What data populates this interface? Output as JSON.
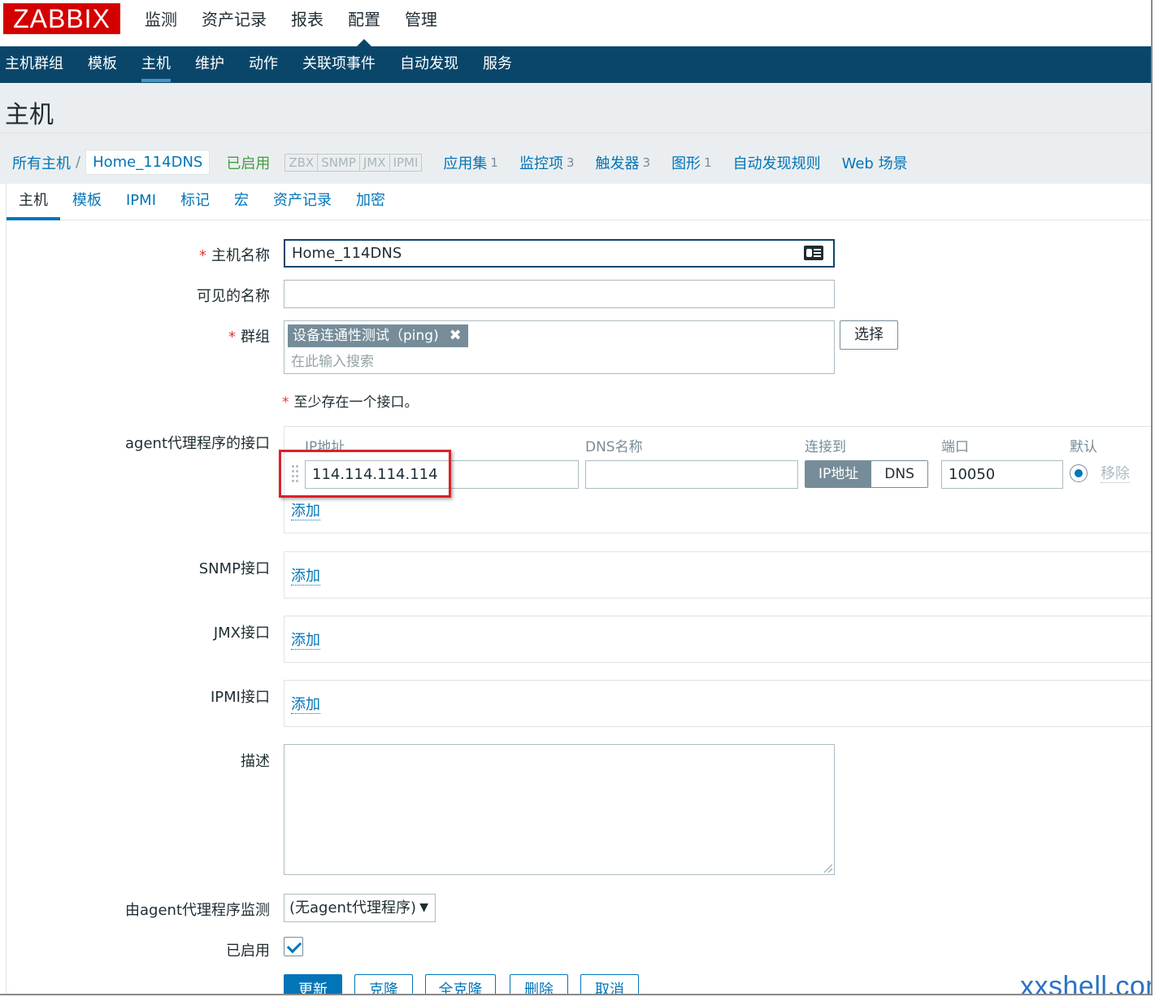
{
  "brand": {
    "logo": "ZABBIX"
  },
  "main_menu": [
    {
      "label": "监测"
    },
    {
      "label": "资产记录"
    },
    {
      "label": "报表"
    },
    {
      "label": "配置",
      "active": true
    },
    {
      "label": "管理"
    }
  ],
  "sub_menu": [
    {
      "label": "主机群组"
    },
    {
      "label": "模板"
    },
    {
      "label": "主机",
      "active": true
    },
    {
      "label": "维护"
    },
    {
      "label": "动作"
    },
    {
      "label": "关联项事件"
    },
    {
      "label": "自动发现"
    },
    {
      "label": "服务"
    }
  ],
  "page": {
    "title": "主机"
  },
  "breadcrumb": {
    "all_hosts": "所有主机",
    "separator": "/",
    "current_host": "Home_114DNS",
    "status": "已启用",
    "availability": [
      "ZBX",
      "SNMP",
      "JMX",
      "IPMI"
    ],
    "links": [
      {
        "label": "应用集",
        "count": "1"
      },
      {
        "label": "监控项",
        "count": "3"
      },
      {
        "label": "触发器",
        "count": "3"
      },
      {
        "label": "图形",
        "count": "1"
      },
      {
        "label": "自动发现规则",
        "count": ""
      },
      {
        "label": "Web 场景",
        "count": ""
      }
    ]
  },
  "tabs": [
    {
      "label": "主机",
      "active": true
    },
    {
      "label": "模板"
    },
    {
      "label": "IPMI"
    },
    {
      "label": "标记"
    },
    {
      "label": "宏"
    },
    {
      "label": "资产记录"
    },
    {
      "label": "加密"
    }
  ],
  "form": {
    "required_mark": "*",
    "host_name_label": "主机名称",
    "host_name_value": "Home_114DNS",
    "visible_name_label": "可见的名称",
    "visible_name_value": "",
    "groups_label": "群组",
    "group_tag": "设备连通性测试（ping)",
    "group_tag_remove": "✖",
    "groups_placeholder": "在此输入搜索",
    "select_button": "选择",
    "interface_note": "至少存在一个接口。",
    "agent_interfaces_label": "agent代理程序的接口",
    "iface_columns": {
      "ip": "IP地址",
      "dns": "DNS名称",
      "connect": "连接到",
      "port": "端口",
      "default": "默认"
    },
    "agent_interface": {
      "ip": "114.114.114.114",
      "dns": "",
      "connect_ip": "IP地址",
      "connect_dns": "DNS",
      "connect_selected": "IP地址",
      "port": "10050",
      "remove": "移除"
    },
    "add_link": "添加",
    "snmp_label": "SNMP接口",
    "jmx_label": "JMX接口",
    "ipmi_label": "IPMI接口",
    "description_label": "描述",
    "description_value": "",
    "proxy_label": "由agent代理程序监测",
    "proxy_value": "(无agent代理程序)",
    "proxy_caret": "▼",
    "enabled_label": "已启用",
    "enabled_checked": true
  },
  "actions": {
    "update": "更新",
    "clone": "克隆",
    "full_clone": "全克隆",
    "delete": "删除",
    "cancel": "取消"
  },
  "watermark": "xxshell.com",
  "colors": {
    "logo_bg": "#d40000",
    "nav_bg": "#0a466a",
    "link": "#0275b8",
    "enabled": "#429e47",
    "highlight_box": "#d9222a"
  }
}
